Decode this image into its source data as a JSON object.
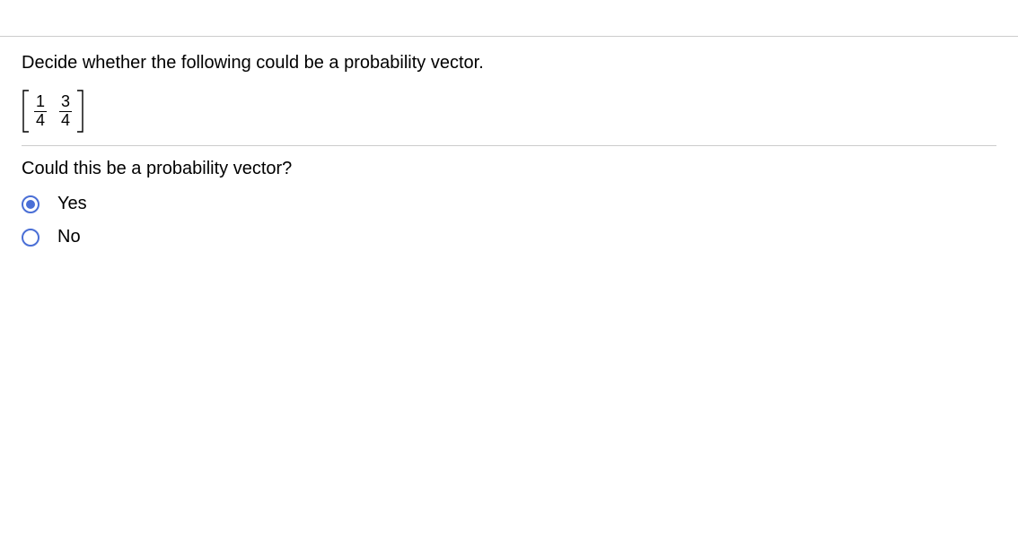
{
  "question": {
    "prompt": "Decide whether the following could be a probability vector.",
    "vector": {
      "entry1": {
        "num": "1",
        "den": "4"
      },
      "entry2": {
        "num": "3",
        "den": "4"
      }
    },
    "answer_prompt": "Could this be a probability vector?"
  },
  "options": [
    {
      "label": "Yes",
      "selected": true
    },
    {
      "label": "No",
      "selected": false
    }
  ]
}
